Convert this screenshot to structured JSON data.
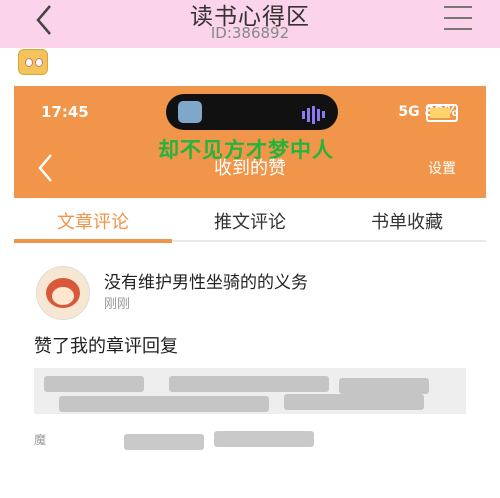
{
  "header": {
    "title": "读书心得区",
    "id_text": "ID:386892"
  },
  "statusbar": {
    "time": "17:45",
    "battery": "89%"
  },
  "overlay_text": "却不见方才梦中人",
  "page": {
    "title": "收到的赞",
    "settings": "设置"
  },
  "tabs": [
    {
      "label": "文章评论",
      "active": true
    },
    {
      "label": "推文评论",
      "active": false
    },
    {
      "label": "书单收藏",
      "active": false
    }
  ],
  "item": {
    "username": "没有维护男性坐骑的的义务",
    "time": "刚刚",
    "action": "赞了我的章评回复",
    "footer_fragment": "魔"
  }
}
